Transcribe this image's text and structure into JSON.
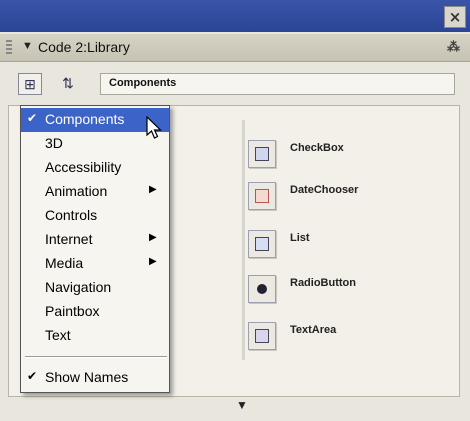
{
  "window": {
    "close_icon": "close-icon"
  },
  "panel": {
    "title": "Code 2:Library",
    "collapse_icon": "triangle-down-icon",
    "menu_icon": "panel-options-icon"
  },
  "toolbar": {
    "library_value": "Components"
  },
  "menu": {
    "items": [
      {
        "label": "Components",
        "checked": true,
        "submenu": false
      },
      {
        "label": "3D",
        "checked": false,
        "submenu": false
      },
      {
        "label": "Accessibility",
        "checked": false,
        "submenu": false
      },
      {
        "label": "Animation",
        "checked": false,
        "submenu": true
      },
      {
        "label": "Controls",
        "checked": false,
        "submenu": false
      },
      {
        "label": "Internet",
        "checked": false,
        "submenu": true
      },
      {
        "label": "Media",
        "checked": false,
        "submenu": true
      },
      {
        "label": "Navigation",
        "checked": false,
        "submenu": false
      },
      {
        "label": "Paintbox",
        "checked": false,
        "submenu": false
      },
      {
        "label": "Text",
        "checked": false,
        "submenu": false
      }
    ],
    "show_names": "Show Names"
  },
  "components": [
    {
      "label": "CheckBox",
      "icon": "checkbox-icon"
    },
    {
      "label": "DateChooser",
      "icon": "datechooser-icon"
    },
    {
      "label": "List",
      "icon": "list-icon"
    },
    {
      "label": "RadioButton",
      "icon": "radiobutton-icon"
    },
    {
      "label": "TextArea",
      "icon": "textarea-icon"
    }
  ],
  "colors": {
    "title_bar": "#2a4595",
    "menu_highlight": "#3c63c8",
    "background": "#e9e6dd"
  }
}
